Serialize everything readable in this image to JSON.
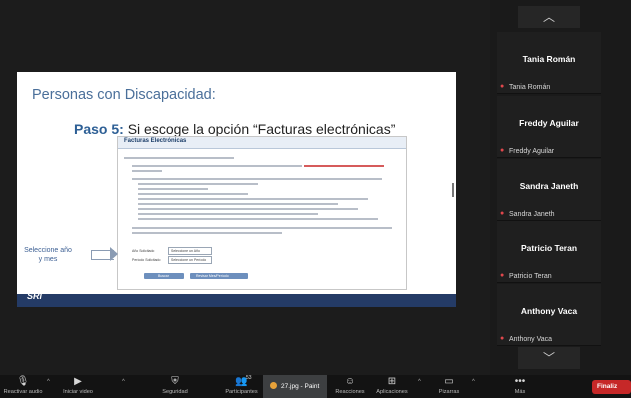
{
  "slide": {
    "title": "Personas con Discapacidad:",
    "step_label": "Paso 5:",
    "step_text": " Si escoge la opción “Facturas electrónicas”",
    "doc_title": "Facturas Electrónicas",
    "side_label": "Seleccione año y mes",
    "doc_labels": [
      "Año Solicitado",
      "Período Solicitado"
    ],
    "doc_selects": [
      "Seleccione un Año",
      "Seleccione un Período"
    ],
    "doc_buttons": [
      "Buscar",
      "Revisar Mes/Período"
    ],
    "footer_logo": "SRi"
  },
  "participants": [
    {
      "name": "Tania Román",
      "sub": "Tania Román"
    },
    {
      "name": "Freddy Aguilar",
      "sub": "Freddy Aguilar"
    },
    {
      "name": "Sandra Janeth",
      "sub": "Sandra Janeth"
    },
    {
      "name": "Patricio Teran",
      "sub": "Patricio Teran"
    },
    {
      "name": "Anthony Vaca",
      "sub": "Anthony Vaca"
    }
  ],
  "toolbar": {
    "items": [
      {
        "label": "Reactivar audio",
        "icon": "mic-muted-icon"
      },
      {
        "label": "Iniciar video",
        "icon": "video-off-icon"
      },
      {
        "label": "Seguridad",
        "icon": "shield-icon"
      },
      {
        "label": "Participantes",
        "icon": "participants-icon",
        "count": "53"
      },
      {
        "label": "Reacciones",
        "icon": "reactions-icon"
      },
      {
        "label": "Aplicaciones",
        "icon": "apps-icon"
      },
      {
        "label": "Pizarras",
        "icon": "whiteboard-icon"
      },
      {
        "label": "Más",
        "icon": "more-icon"
      }
    ],
    "paint_tab": "27.jpg - Paint",
    "end_label": "Finaliz"
  }
}
